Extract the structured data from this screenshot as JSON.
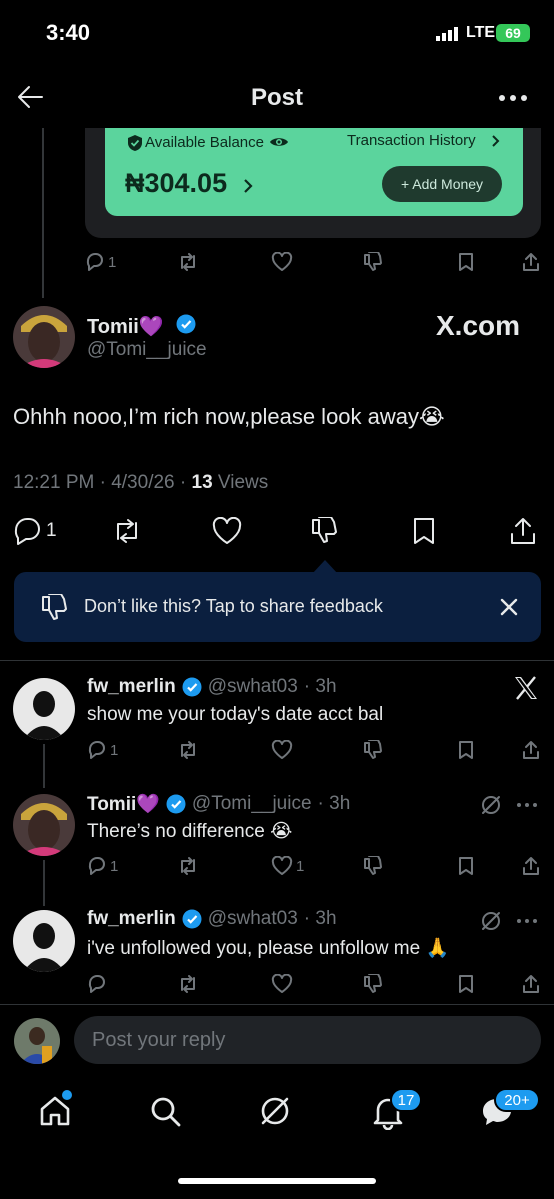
{
  "status_bar": {
    "time": "3:40",
    "network": "LTE",
    "battery": "69"
  },
  "header": {
    "title": "Post"
  },
  "embedded_card": {
    "available_label": "Available Balance",
    "history_label": "Transaction History",
    "balance": "₦304.05",
    "add_money": "+ Add Money"
  },
  "quoted_actions": {
    "reply_count": "1"
  },
  "post": {
    "name": "Tomii💜",
    "handle": "@Tomi__juice",
    "watermark": "X.com",
    "text": "Ohhh nooo,I’m rich now,please look away😭",
    "time_date": "12:21 PM · 4/30/26 · ",
    "views_count": "13",
    "views_label": " Views",
    "reply_count": "1"
  },
  "feedback": {
    "text": "Don’t like this? Tap to share feedback"
  },
  "replies": [
    {
      "name": "fw_merlin",
      "handle": "@swhat03",
      "age": "· 3h",
      "text": "show me your today's date acct bal",
      "reply_count": "1",
      "like_count": ""
    },
    {
      "name": "Tomii💜",
      "handle": "@Tomi__juice",
      "age": "· 3h",
      "text": "There’s no difference 😭",
      "reply_count": "1",
      "like_count": "1"
    },
    {
      "name": "fw_merlin",
      "handle": "@swhat03",
      "age": "· 3h",
      "text": "i've unfollowed you, please unfollow me 🙏",
      "reply_count": "",
      "like_count": ""
    }
  ],
  "composer": {
    "placeholder": "Post your reply"
  },
  "tab_bar": {
    "notifications_badge": "17",
    "messages_badge": "20+"
  }
}
